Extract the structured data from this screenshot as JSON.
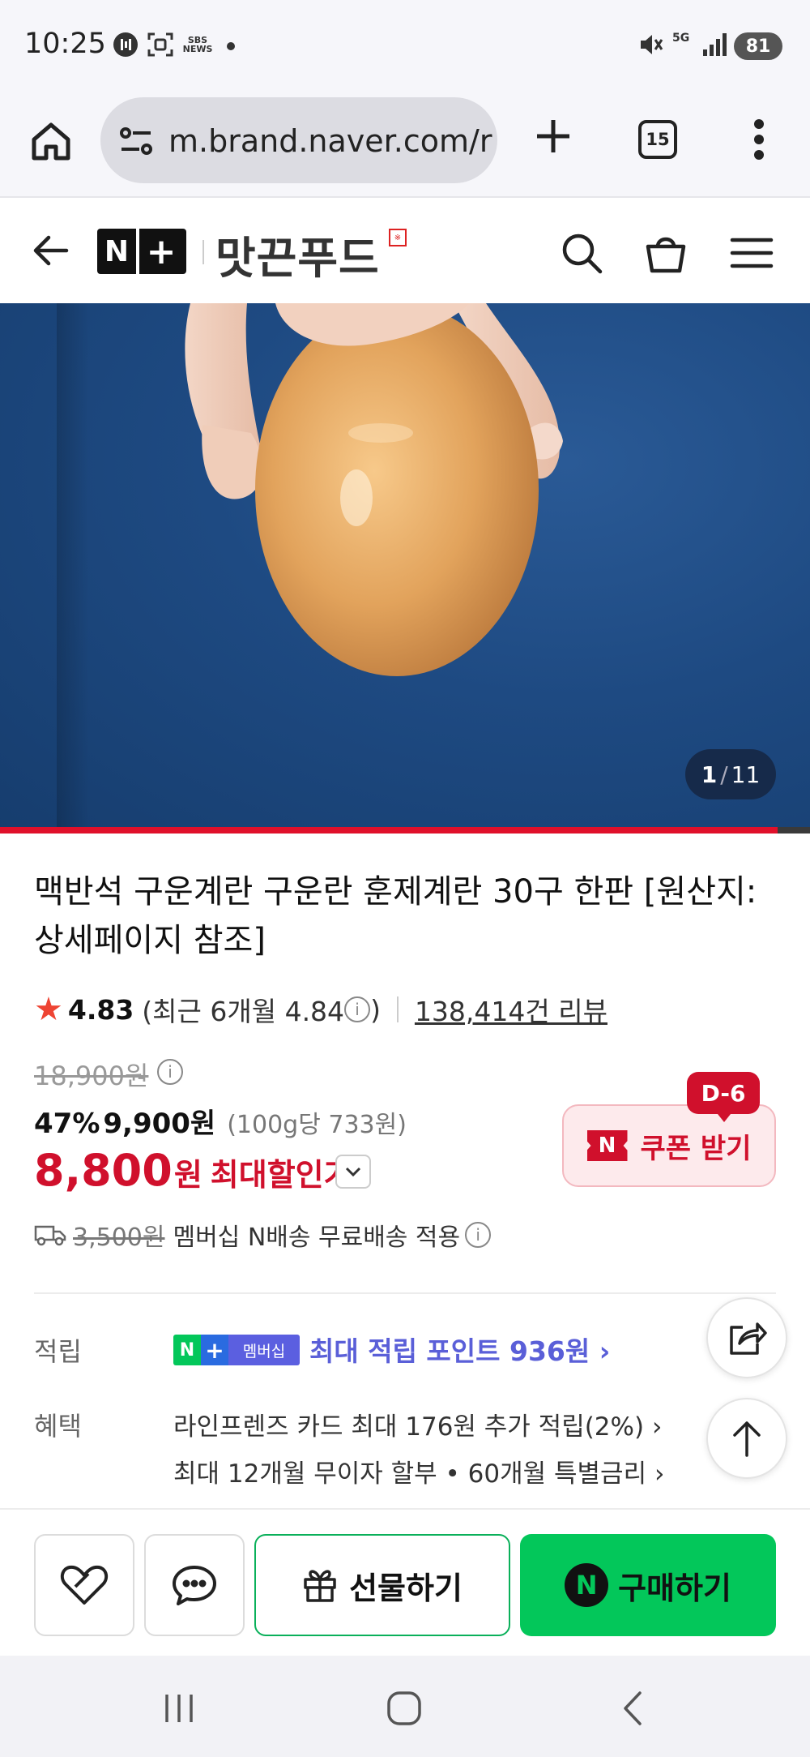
{
  "status_bar": {
    "time": "10:25",
    "sbs_icon_text": "SBS\nNEWS",
    "network": "5G",
    "battery": "81"
  },
  "browser": {
    "url": "m.brand.naver.com/r",
    "tab_count": "15"
  },
  "brand": {
    "logo_n": "N",
    "logo_plus": "+",
    "name": "맛끈푸드",
    "seal": "※"
  },
  "hero": {
    "current_slide": "1",
    "separator": "/",
    "total_slides": "11",
    "progress_fraction": 0.96
  },
  "product": {
    "title": "맥반석 구운계란 구운란 훈제계란 30구 한판 [원산지: 상세페이지 참조]",
    "rating": "4.83",
    "recent_rating": "(최근 6개월 4.84",
    "recent_rating_close": ")",
    "review_count": "138,414건 리뷰",
    "original_price": "18,900원",
    "discount_rate": "47%",
    "sale_price": "9,900원",
    "unit_price": "(100g당 733원)",
    "max_price": "8,800",
    "max_price_won": "원",
    "max_price_label": "최대할인가",
    "shipping_old": "3,500원",
    "shipping_text": "멤버십 N배송 무료배송 적용"
  },
  "coupon": {
    "badge": "D-6",
    "icon_text": "N",
    "label": "쿠폰 받기"
  },
  "benefits": {
    "points_label": "적립",
    "badge_n": "N",
    "badge_plus": "+",
    "badge_membership": "멤버십",
    "points_text": "최대 적립 포인트 936원 ›",
    "benefit_label": "혜택",
    "benefit_1": "라인프렌즈 카드 최대 176원 추가 적립(2%) ›",
    "benefit_2": "최대 12개월 무이자 할부 • 60개월 특별금리 ›"
  },
  "actions": {
    "gift_label": "선물하기",
    "buy_icon_text": "N",
    "buy_label": "구매하기"
  },
  "colors": {
    "brand_green": "#03c75a",
    "sale_red": "#d0102c",
    "points_purple": "#5a5fd8",
    "hero_blue": "#1e4a82"
  }
}
